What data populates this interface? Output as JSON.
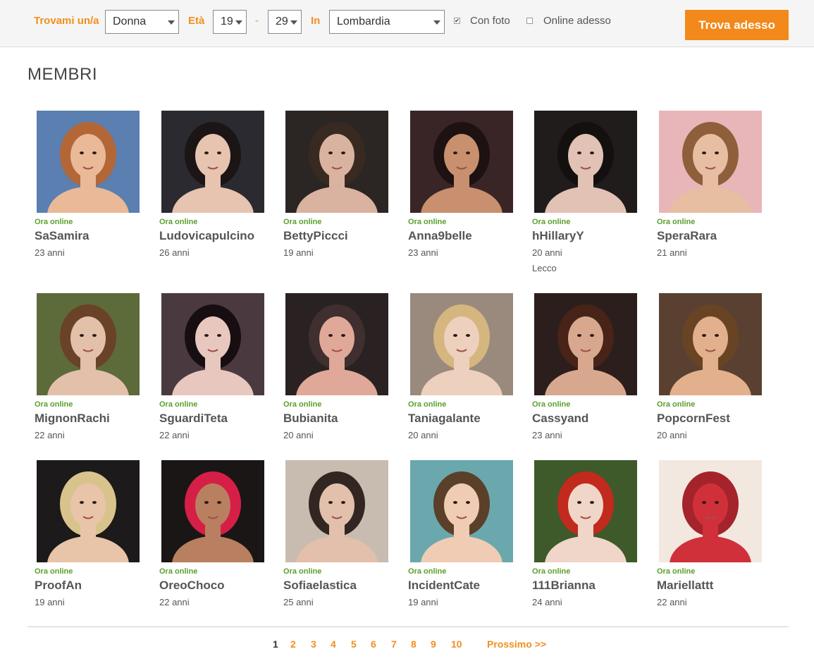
{
  "search": {
    "find_label": "Trovami un/a",
    "gender_value": "Donna",
    "age_label": "Età",
    "age_min": "19",
    "age_separator": "-",
    "age_max": "29",
    "in_label": "In",
    "region_value": "Lombardia",
    "with_photo_label": "Con foto",
    "with_photo_checked": true,
    "online_now_label": "Online adesso",
    "online_now_checked": false,
    "submit_label": "Trova adesso"
  },
  "title": "MEMBRI",
  "members": [
    {
      "status": "Ora online",
      "name": "SaSamira",
      "age": "23 anni",
      "bg": "#5a7fb0",
      "skin": "#e9b998",
      "hair": "#b8652f"
    },
    {
      "status": "Ora online",
      "name": "Ludovicapulcino",
      "age": "26 anni",
      "bg": "#2a2a30",
      "skin": "#e6c4b0",
      "hair": "#1a1414"
    },
    {
      "status": "Ora online",
      "name": "BettyPiccci",
      "age": "19 anni",
      "bg": "#2b2624",
      "skin": "#d9b3a0",
      "hair": "#3a2a22"
    },
    {
      "status": "Ora online",
      "name": "Anna9belle",
      "age": "23 anni",
      "bg": "#3a2526",
      "skin": "#c8906e",
      "hair": "#1c1010"
    },
    {
      "status": "Ora online",
      "name": "hHillaryY",
      "age": "20 anni",
      "city": "Lecco",
      "bg": "#201c1c",
      "skin": "#e2c2b4",
      "hair": "#141010"
    },
    {
      "status": "Ora online",
      "name": "SperaRara",
      "age": "21 anni",
      "bg": "#e8b6b8",
      "skin": "#e7bea2",
      "hair": "#8a5a34"
    },
    {
      "status": "Ora online",
      "name": "MignonRachi",
      "age": "22 anni",
      "bg": "#5d6a3a",
      "skin": "#e3c0aa",
      "hair": "#6a4026"
    },
    {
      "status": "Ora online",
      "name": "SguardiTeta",
      "age": "22 anni",
      "bg": "#4a3a40",
      "skin": "#e8c8be",
      "hair": "#140c10"
    },
    {
      "status": "Ora online",
      "name": "Bubianita",
      "age": "20 anni",
      "bg": "#2a2222",
      "skin": "#e0a898",
      "hair": "#403030"
    },
    {
      "status": "Ora online",
      "name": "Taniagalante",
      "age": "20 anni",
      "bg": "#9a8a7e",
      "skin": "#edd0bd",
      "hair": "#d8b880"
    },
    {
      "status": "Ora online",
      "name": "Cassyand",
      "age": "23 anni",
      "bg": "#2c1e1c",
      "skin": "#d8a88e",
      "hair": "#4a2418"
    },
    {
      "status": "Ora online",
      "name": "PopcornFest",
      "age": "20 anni",
      "bg": "#5a4030",
      "skin": "#e2b08c",
      "hair": "#6a4424"
    },
    {
      "status": "Ora online",
      "name": "ProofAn",
      "age": "19 anni",
      "bg": "#1c1a1a",
      "skin": "#e8c4a8",
      "hair": "#e4cc92"
    },
    {
      "status": "Ora online",
      "name": "OreoChoco",
      "age": "22 anni",
      "bg": "#1a1616",
      "skin": "#b88060",
      "hair": "#e0204a"
    },
    {
      "status": "Ora online",
      "name": "Sofiaelastica",
      "age": "25 anni",
      "bg": "#c8bcb0",
      "skin": "#e2c0ac",
      "hair": "#2a1e1a"
    },
    {
      "status": "Ora online",
      "name": "IncidentCate",
      "age": "19 anni",
      "bg": "#6aa8ae",
      "skin": "#f0ccb4",
      "hair": "#5a3a22"
    },
    {
      "status": "Ora online",
      "name": "111Brianna",
      "age": "24 anni",
      "bg": "#3e5a2a",
      "skin": "#f0d6c8",
      "hair": "#c8281c"
    },
    {
      "status": "Ora online",
      "name": "Mariellattt",
      "age": "22 anni",
      "bg": "#f2e8e0",
      "skin": "#d0303a",
      "hair": "#a01820"
    }
  ],
  "pagination": {
    "pages": [
      "1",
      "2",
      "3",
      "4",
      "5",
      "6",
      "7",
      "8",
      "9",
      "10"
    ],
    "current": "1",
    "next_label": "Prossimo >>"
  },
  "colors": {
    "accent": "#f2891a",
    "online_green": "#5aa02c"
  }
}
